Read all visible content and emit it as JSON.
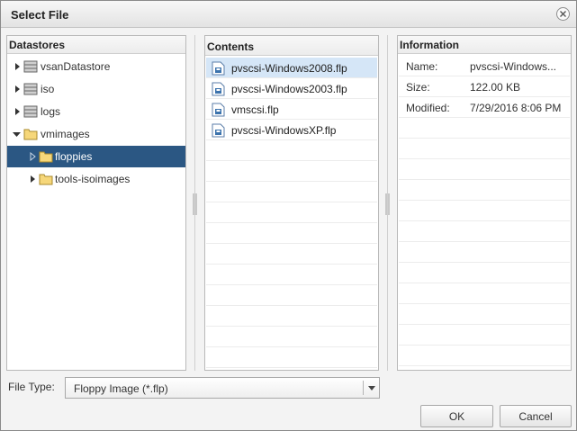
{
  "dialog": {
    "title": "Select File"
  },
  "datastores": {
    "header": "Datastores",
    "items": [
      {
        "label": "vsanDatastore",
        "icon": "database-icon",
        "expanded": false,
        "selected": false
      },
      {
        "label": "iso",
        "icon": "database-icon",
        "expanded": false,
        "selected": false
      },
      {
        "label": "logs",
        "icon": "database-icon",
        "expanded": false,
        "selected": false
      },
      {
        "label": "vmimages",
        "icon": "folder-open-icon",
        "expanded": true,
        "selected": false
      },
      {
        "label": "floppies",
        "icon": "folder-icon",
        "expanded": false,
        "selected": true
      },
      {
        "label": "tools-isoimages",
        "icon": "folder-icon",
        "expanded": false,
        "selected": false
      }
    ]
  },
  "contents": {
    "header": "Contents",
    "files": [
      {
        "label": "pvscsi-Windows2008.flp",
        "icon": "floppy-file-icon",
        "selected": true
      },
      {
        "label": "pvscsi-Windows2003.flp",
        "icon": "floppy-file-icon",
        "selected": false
      },
      {
        "label": "vmscsi.flp",
        "icon": "floppy-file-icon",
        "selected": false
      },
      {
        "label": "pvscsi-WindowsXP.flp",
        "icon": "floppy-file-icon",
        "selected": false
      }
    ]
  },
  "information": {
    "header": "Information",
    "rows": [
      {
        "key": "Name:",
        "value": "pvscsi-Windows..."
      },
      {
        "key": "Size:",
        "value": "122.00 KB"
      },
      {
        "key": "Modified:",
        "value": "7/29/2016 8:06 PM"
      }
    ]
  },
  "file_type": {
    "label": "File Type:",
    "selected": "Floppy Image (*.flp)"
  },
  "buttons": {
    "ok": "OK",
    "cancel": "Cancel"
  },
  "colors": {
    "tree_selection": "#2b5783",
    "file_selection": "#d5e6f7"
  }
}
